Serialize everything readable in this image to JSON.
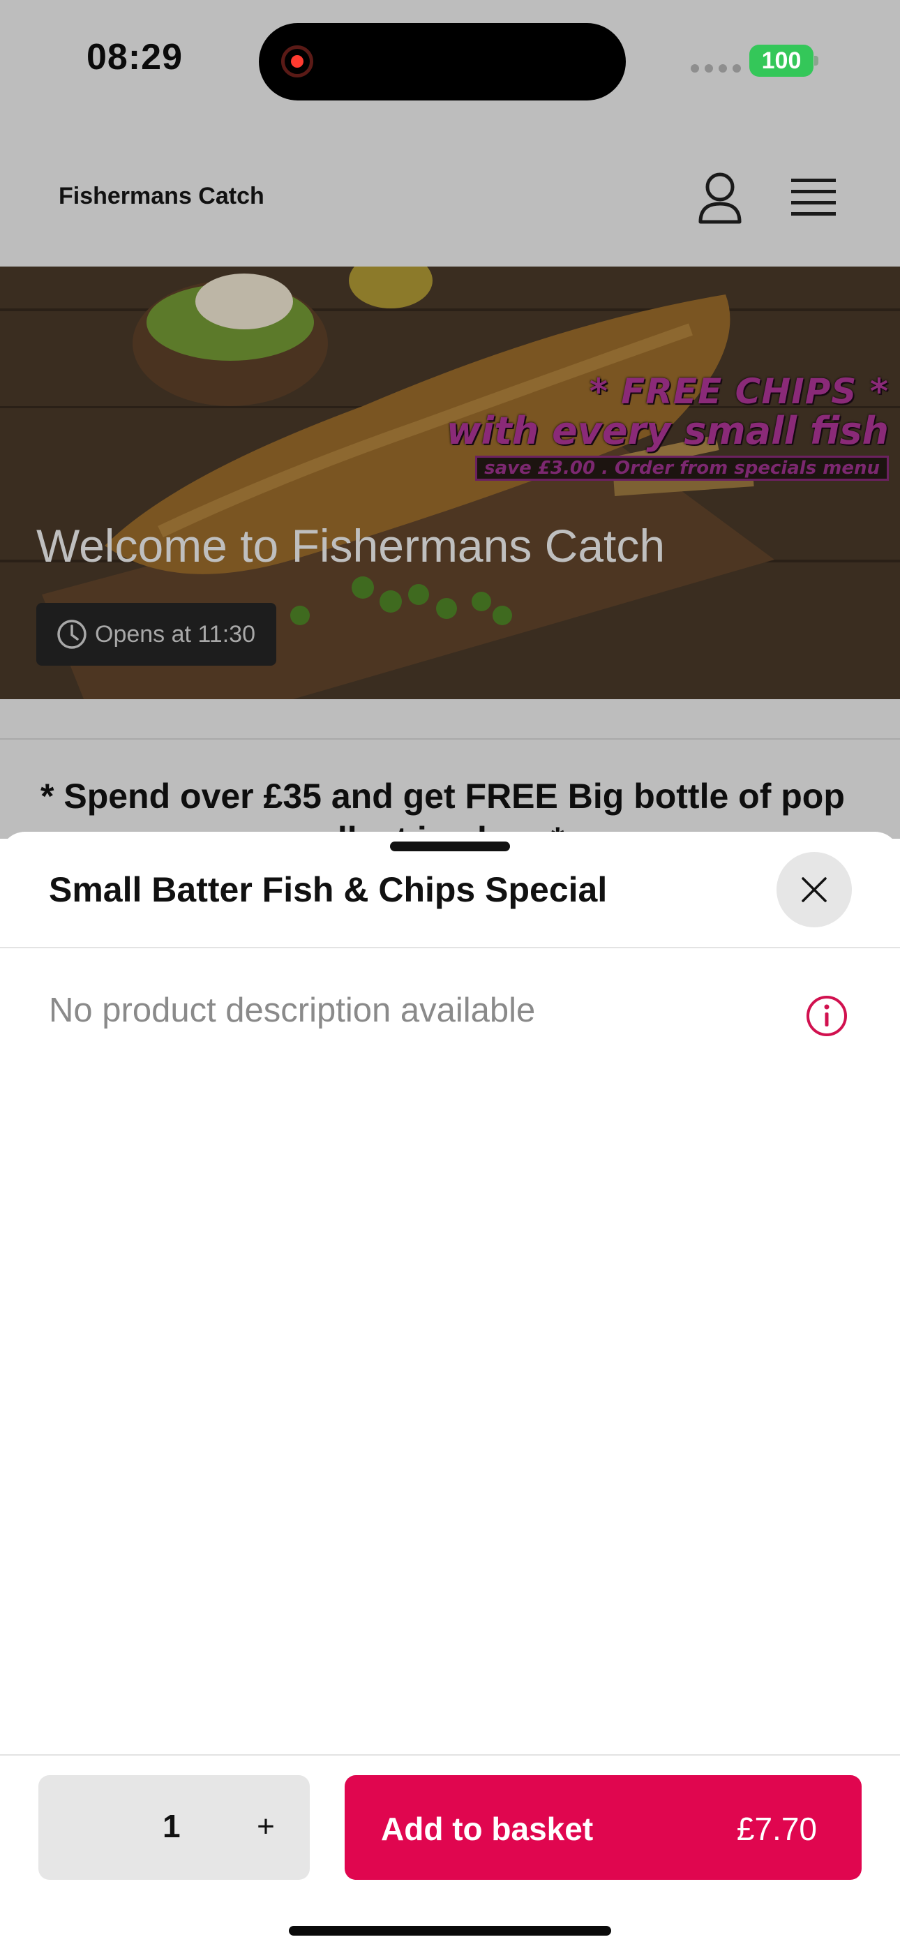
{
  "status_bar": {
    "time": "08:29",
    "battery": "100",
    "battery_color": "#34c759",
    "recording_color": "#ff3b30"
  },
  "header": {
    "brand": "Fishermans Catch",
    "account_icon": "user-icon",
    "menu_icon": "hamburger-menu-icon"
  },
  "hero": {
    "promo_line_1": "* FREE CHIPS *",
    "promo_line_2": "with every small fish",
    "promo_line_3": "save £3.00 . Order from specials menu",
    "title": "Welcome to Fishermans Catch",
    "opens": "Opens at 11:30",
    "opens_icon": "clock-icon"
  },
  "banner": {
    "line_1": "* Spend over £35 and get FREE Big bottle of pop",
    "line_2": "... collect in shop *"
  },
  "sheet": {
    "title": "Small Batter Fish & Chips Special",
    "close_icon": "close-icon",
    "description": "No product description available",
    "info_icon": "info-icon",
    "quantity": "1",
    "increment_label": "+",
    "add_label": "Add to basket",
    "price": "£7.70",
    "accent_color": "#e0064f"
  }
}
